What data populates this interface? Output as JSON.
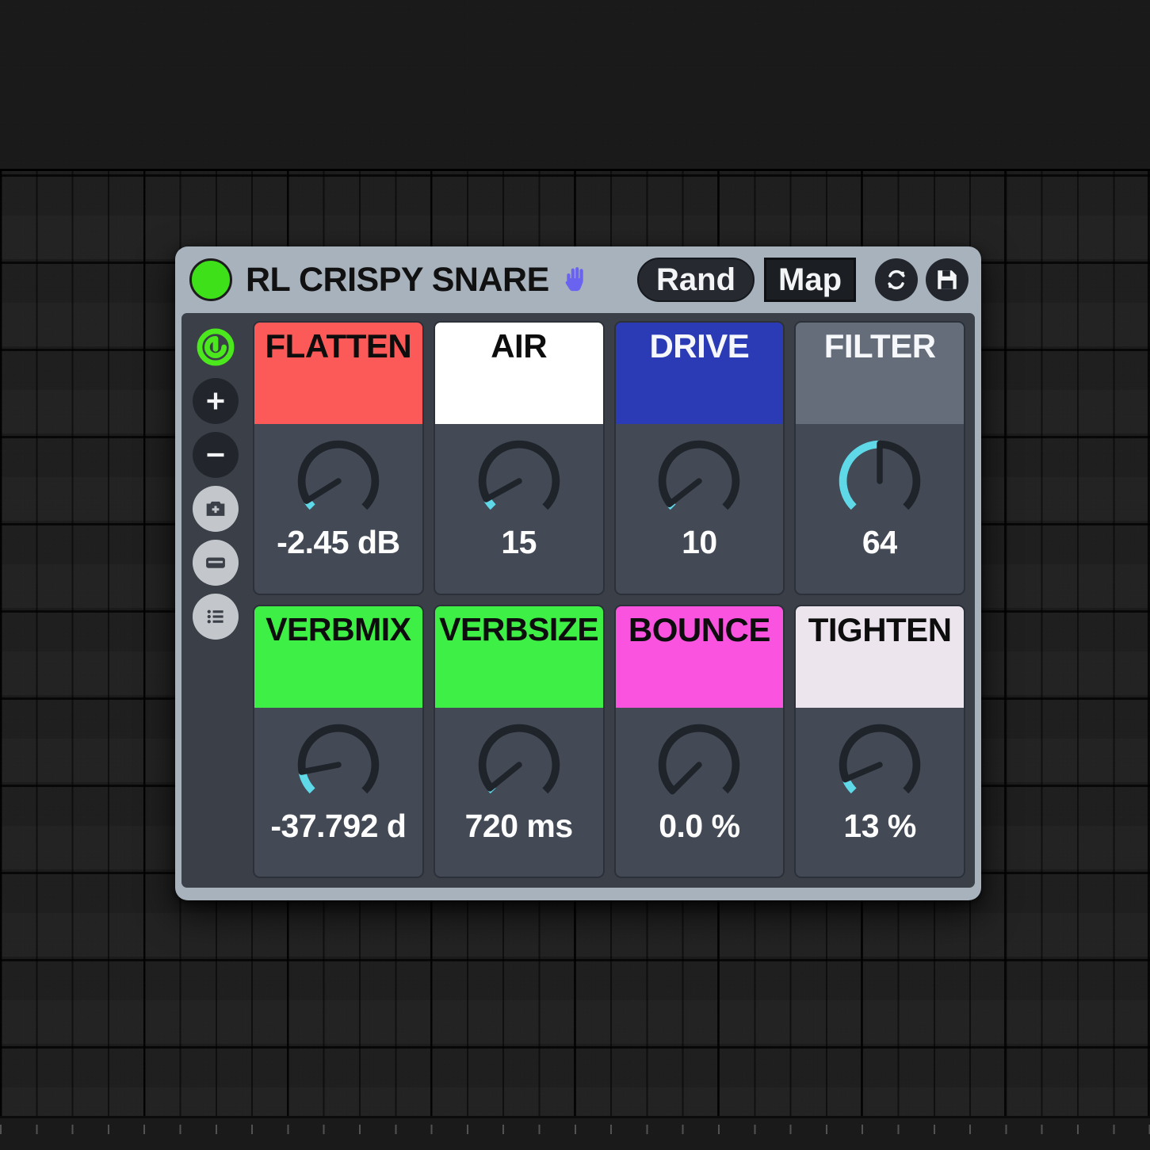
{
  "device": {
    "title": "RL CRISPY SNARE",
    "led_color": "#3ee019",
    "hand_emoji": "🖐",
    "hand_color": "#6a63f0",
    "panel_color": "#a8b2bd"
  },
  "titlebar": {
    "rand_label": "Rand",
    "map_label": "Map",
    "refresh_icon": "refresh-icon",
    "save_icon": "save-icon"
  },
  "sidebar": {
    "items": [
      {
        "name": "logo-icon",
        "style": "logo",
        "label": ""
      },
      {
        "name": "add-icon",
        "style": "dark",
        "label": "+"
      },
      {
        "name": "remove-icon",
        "style": "dark",
        "label": "−"
      },
      {
        "name": "snapshot-add-icon",
        "style": "light",
        "label": ""
      },
      {
        "name": "card-icon",
        "style": "light",
        "label": ""
      },
      {
        "name": "list-icon",
        "style": "light",
        "label": ""
      }
    ]
  },
  "accent": {
    "knob_track": "#1f232a",
    "knob_fill": "#5fd8e8",
    "knob_pointer": "#1f232a"
  },
  "params": [
    {
      "label": "FLATTEN",
      "label_lines": [
        "FLATTEN"
      ],
      "label_bg": "#fc5a58",
      "label_fg": "#0d0d0d",
      "value": "-2.45 dB",
      "knob_angle": -122,
      "fill_start": -135,
      "fill_end": -122,
      "clipped": false
    },
    {
      "label": "AIR",
      "label_lines": [
        "AIR"
      ],
      "label_bg": "#ffffff",
      "label_fg": "#0d0d0d",
      "value": "15",
      "knob_angle": -119,
      "fill_start": -135,
      "fill_end": -119,
      "clipped": false
    },
    {
      "label": "DRIVE",
      "label_lines": [
        "DRIVE"
      ],
      "label_bg": "#2b3bb5",
      "label_fg": "#f5f7fa",
      "value": "10",
      "knob_angle": -128,
      "fill_start": -135,
      "fill_end": -128,
      "clipped": false
    },
    {
      "label": "FILTER",
      "label_lines": [
        "FILTER"
      ],
      "label_bg": "#646d79",
      "label_fg": "#f5f7fa",
      "value": "64",
      "knob_angle": 0,
      "fill_start": -135,
      "fill_end": 0,
      "clipped": false
    },
    {
      "label": "VERB MIX",
      "label_lines": [
        "VERB",
        "MIX"
      ],
      "label_bg": "#3ef046",
      "label_fg": "#0d0d0d",
      "value": "-37.792 d",
      "knob_angle": -101,
      "fill_start": -135,
      "fill_end": -101,
      "clipped": true
    },
    {
      "label": "VERB SIZE",
      "label_lines": [
        "VERB",
        "SIZE"
      ],
      "label_bg": "#3ef046",
      "label_fg": "#0d0d0d",
      "value": "720 ms",
      "knob_angle": -129,
      "fill_start": -135,
      "fill_end": -129,
      "clipped": false
    },
    {
      "label": "BOUNCE",
      "label_lines": [
        "BOUNCE"
      ],
      "label_bg": "#fa53e0",
      "label_fg": "#0d0d0d",
      "value": "0.0 %",
      "knob_angle": -135,
      "fill_start": -135,
      "fill_end": -135,
      "clipped": false
    },
    {
      "label": "TIGHTEN",
      "label_lines": [
        "TIGHTEN"
      ],
      "label_bg": "#ece5ee",
      "label_fg": "#0d0d0d",
      "value": "13 %",
      "knob_angle": -113,
      "fill_start": -135,
      "fill_end": -113,
      "clipped": false
    }
  ]
}
